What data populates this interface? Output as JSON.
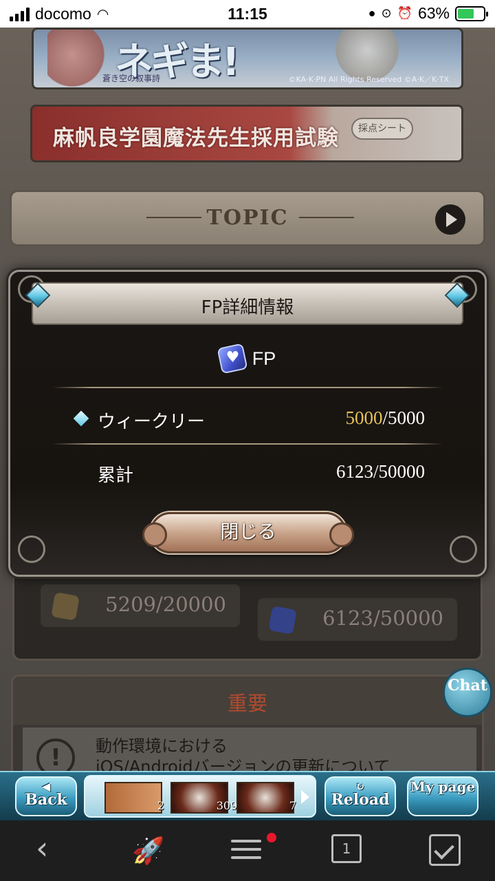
{
  "status": {
    "carrier": "docomo",
    "time": "11:15",
    "battery_percent": "63%"
  },
  "banners": {
    "negima_logo": "ネギま!",
    "negima_sub": "蒼き空の叙事詩",
    "copyright": "©KA·K·PN All Rights Reserved ©A·K／K·TX",
    "exam_title": "麻帆良学園魔法先生採用試験",
    "exam_sheet": "採点シート"
  },
  "topic": {
    "label": "TOPIC"
  },
  "background_stats": {
    "box1": "5209/20000",
    "box2": "6123/50000"
  },
  "important": {
    "title": "重要",
    "news_line1": "動作環境における",
    "news_line2": "iOS/Androidバージョンの更新について"
  },
  "chat": {
    "label": "Chat"
  },
  "modal": {
    "title": "FP詳細情報",
    "fp_label": "FP",
    "weekly_label": "ウィークリー",
    "weekly_current": "5000",
    "weekly_max": "/5000",
    "total_label": "累計",
    "total_value": "6123/50000",
    "close_label": "閉じる"
  },
  "game_nav": {
    "back_label": "Back",
    "reload_label": "Reload",
    "mypage_label": "My page",
    "thumbnails": [
      {
        "count": "2"
      },
      {
        "count": "309"
      },
      {
        "count": "7"
      }
    ]
  },
  "browser_toolbar": {
    "tabs_count": "1"
  },
  "colors": {
    "highlight_gold": "#e5c15a",
    "accent_blue": "#5fc7e4",
    "important_red": "#b34a2e"
  }
}
